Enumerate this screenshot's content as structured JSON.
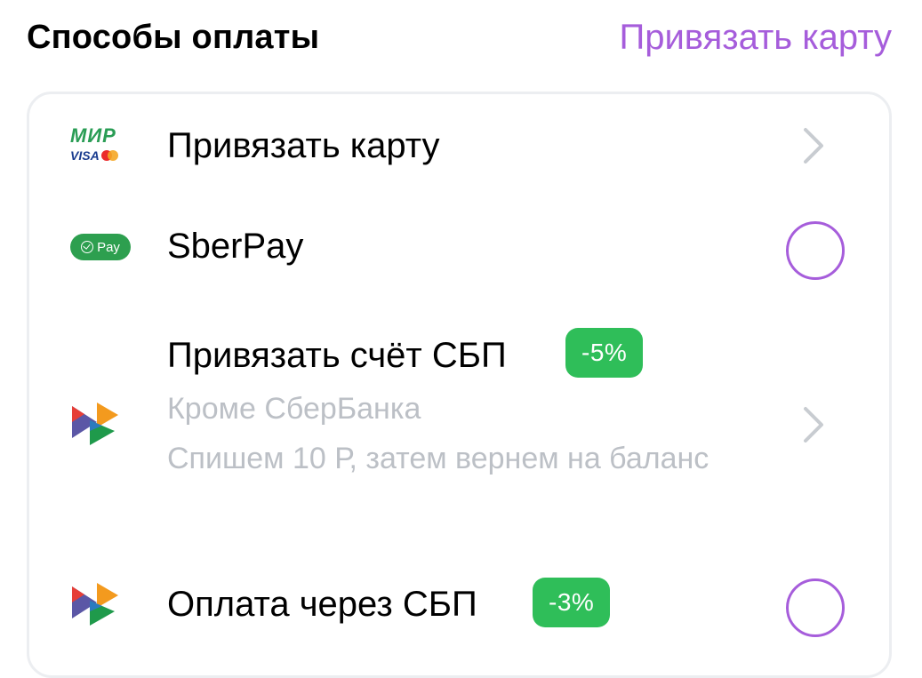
{
  "header": {
    "title": "Способы оплаты",
    "link_label": "Привязать карту"
  },
  "colors": {
    "accent": "#a65ddb",
    "badge_green": "#2fbe59",
    "muted_text": "#bcc0c6"
  },
  "payment_methods": [
    {
      "icon": "mir-visa-mastercard-logo",
      "logo_text_top": "МИР",
      "logo_text_bottom": "VISA",
      "title": "Привязать карту",
      "control": "chevron"
    },
    {
      "icon": "sberpay-logo",
      "logo_text": "Pay",
      "title": "SberPay",
      "control": "radio",
      "selected": false
    },
    {
      "icon": "sbp-logo",
      "title": "Привязать счёт СБП",
      "badge": "-5%",
      "subtitle_line1": "Кроме СберБанка",
      "subtitle_line2": "Спишем 10 Р, затем вернем на баланс",
      "control": "chevron"
    },
    {
      "icon": "sbp-logo",
      "title": "Оплата через СБП",
      "badge": "-3%",
      "control": "radio",
      "selected": false
    }
  ]
}
